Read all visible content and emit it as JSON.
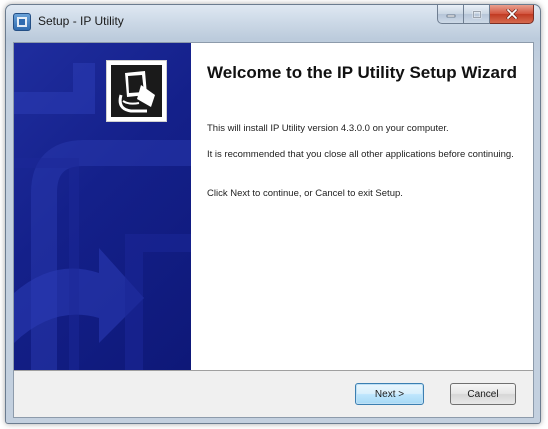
{
  "window": {
    "title": "Setup - IP Utility"
  },
  "caption_buttons": {
    "minimize_icon": "minimize-icon",
    "maximize_icon": "maximize-icon",
    "close_icon": "close-icon"
  },
  "wizard": {
    "heading": "Welcome to the IP Utility Setup Wizard",
    "paragraphs": [
      "This will install IP Utility version 4.3.0.0 on your computer.",
      "It is recommended that you close all other applications before continuing.",
      "Click Next to continue, or Cancel to exit Setup."
    ]
  },
  "buttons": {
    "next_label": "Next >",
    "cancel_label": "Cancel"
  },
  "colors": {
    "side_panel": "#14208a",
    "close_button": "#c13a22"
  }
}
